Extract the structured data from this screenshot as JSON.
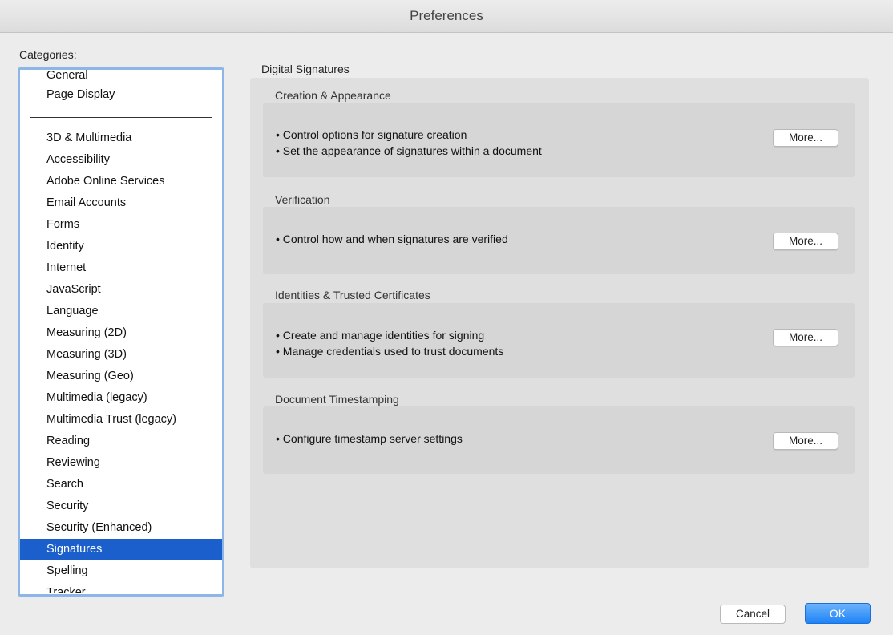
{
  "window": {
    "title": "Preferences"
  },
  "categories": {
    "label": "Categories:",
    "top_items": [
      "General",
      "Page Display"
    ],
    "items": [
      "3D & Multimedia",
      "Accessibility",
      "Adobe Online Services",
      "Email Accounts",
      "Forms",
      "Identity",
      "Internet",
      "JavaScript",
      "Language",
      "Measuring (2D)",
      "Measuring (3D)",
      "Measuring (Geo)",
      "Multimedia (legacy)",
      "Multimedia Trust (legacy)",
      "Reading",
      "Reviewing",
      "Search",
      "Security",
      "Security (Enhanced)",
      "Signatures",
      "Spelling",
      "Tracker"
    ],
    "selected": "Signatures"
  },
  "main": {
    "section_title": "Digital Signatures",
    "groups": [
      {
        "title": "Creation & Appearance",
        "lines": [
          "• Control options for signature creation",
          "• Set the appearance of signatures within a document"
        ],
        "button": "More..."
      },
      {
        "title": "Verification",
        "lines": [
          "• Control how and when signatures are verified"
        ],
        "button": "More..."
      },
      {
        "title": "Identities & Trusted Certificates",
        "lines": [
          "• Create and manage identities for signing",
          "• Manage credentials used to trust documents"
        ],
        "button": "More..."
      },
      {
        "title": "Document Timestamping",
        "lines": [
          "• Configure timestamp server settings"
        ],
        "button": "More..."
      }
    ]
  },
  "footer": {
    "cancel_label": "Cancel",
    "ok_label": "OK"
  },
  "colors": {
    "selection": "#1a5fcb",
    "ok_button": "#1e84f6",
    "list_focus_ring": "#8db5e8"
  }
}
